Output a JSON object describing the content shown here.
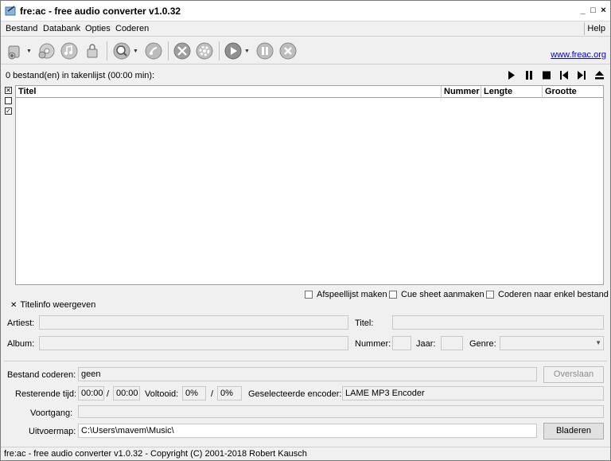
{
  "window": {
    "title": "fre:ac - free audio converter v1.0.32",
    "minimize": "_",
    "restore": "□",
    "close": "×"
  },
  "menu": {
    "items": [
      "Bestand",
      "Databank",
      "Opties",
      "Coderen"
    ],
    "help": "Help"
  },
  "toolbar": {
    "link": "www.freac.org",
    "icons": [
      "add-files-icon",
      "add-cd-icon",
      "cd-icon",
      "lock-icon",
      "search-icon",
      "database-icon",
      "tools-icon",
      "settings-icon",
      "play-encode-icon",
      "pause-icon",
      "stop-icon"
    ]
  },
  "list": {
    "info": "0 bestand(en) in takenlijst (00:00 min):",
    "columns": [
      "Titel",
      "Nummer",
      "Lengte",
      "Grootte"
    ]
  },
  "options": {
    "playlist": "Afspeellijst maken",
    "cuesheet": "Cue sheet aanmaken",
    "single_file": "Coderen naar enkel bestand",
    "show_title_info": "Titelinfo weergeven"
  },
  "tags": {
    "artist_label": "Artiest:",
    "title_label": "Titel:",
    "album_label": "Album:",
    "track_label": "Nummer:",
    "year_label": "Jaar:",
    "genre_label": "Genre:"
  },
  "progress": {
    "encoding_label": "Bestand coderen:",
    "encoding_value": "geen",
    "skip_button": "Overslaan",
    "remaining_label": "Resterende tijd:",
    "remaining_value": "00:00",
    "remaining_sep": "/",
    "remaining_total": "00:00",
    "completed_label": "Voltooid:",
    "completed_value": "0%",
    "completed_sep": "/",
    "completed_total": "0%",
    "encoder_label": "Geselecteerde encoder:",
    "encoder_value": "LAME MP3 Encoder",
    "progress_label": "Voortgang:",
    "output_label": "Uitvoermap:",
    "output_value": "C:\\Users\\mavem\\Music\\",
    "browse_button": "Bladeren"
  },
  "status": "fre:ac - free audio converter v1.0.32 - Copyright (C) 2001-2018 Robert Kausch"
}
